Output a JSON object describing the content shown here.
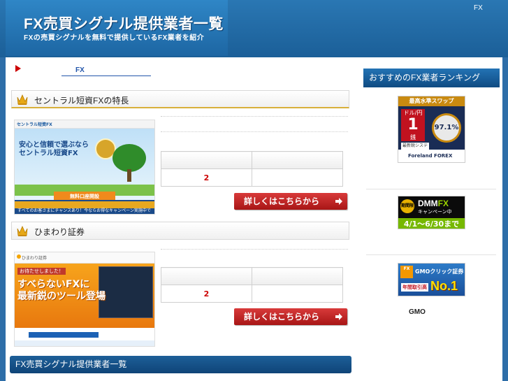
{
  "header": {
    "title": "FX売買シグナル提供業者一覧",
    "subtitle": "FXの売買シグナルを無料で提供しているFX業者を紹介",
    "top_link": "FX"
  },
  "breadcrumb": {
    "link": "FX"
  },
  "sections": [
    {
      "heading": "セントラル短資FXの特長",
      "table": {
        "row2_left": "2",
        "row2_right": ""
      },
      "button_label": "詳しくはこちらから",
      "ad": {
        "logo": "セントラル短資FX",
        "headline_1": "安心と信頼で選ぶなら",
        "headline_2": "セントラル短資FX",
        "cta": "無料口座開設",
        "bottom": "すべてのお客さまにチャンスあり！今ならお得なキャンペーン実施中です"
      }
    },
    {
      "heading": "ひまわり証券",
      "table": {
        "row2_left": "2",
        "row2_right": ""
      },
      "button_label": "詳しくはこちらから",
      "ad": {
        "logo": "ひまわり証券",
        "tag": "お待たせしました！",
        "headline_1": "すべらないFXに",
        "headline_2": "最新鋭のツール登場"
      }
    }
  ],
  "bottom_bar": "FX売買シグナル提供業者一覧",
  "sidebar": {
    "heading": "おすすめのFX業者ランキング",
    "ads": [
      {
        "top": "最高水準スワップ",
        "pair": "ドル/円",
        "big": "1",
        "unit": "銭",
        "circle": "97.1%",
        "system": "最新鋭システム",
        "foot": "Foreland FOREX"
      },
      {
        "tag": "期間限定",
        "brand_a": "DMM",
        "brand_b": "FX",
        "sub": "キャンペーン中",
        "date": "4/1〜6/30まで"
      },
      {
        "fx": "FX",
        "brand": "GMOクリック証券",
        "year": "年間取引高",
        "no1": "No.1"
      }
    ],
    "caption": "GMO"
  },
  "colors": {
    "header_blue": "#1b5f98",
    "accent_red": "#cc0000",
    "gold_rule": "#d8b03a"
  }
}
